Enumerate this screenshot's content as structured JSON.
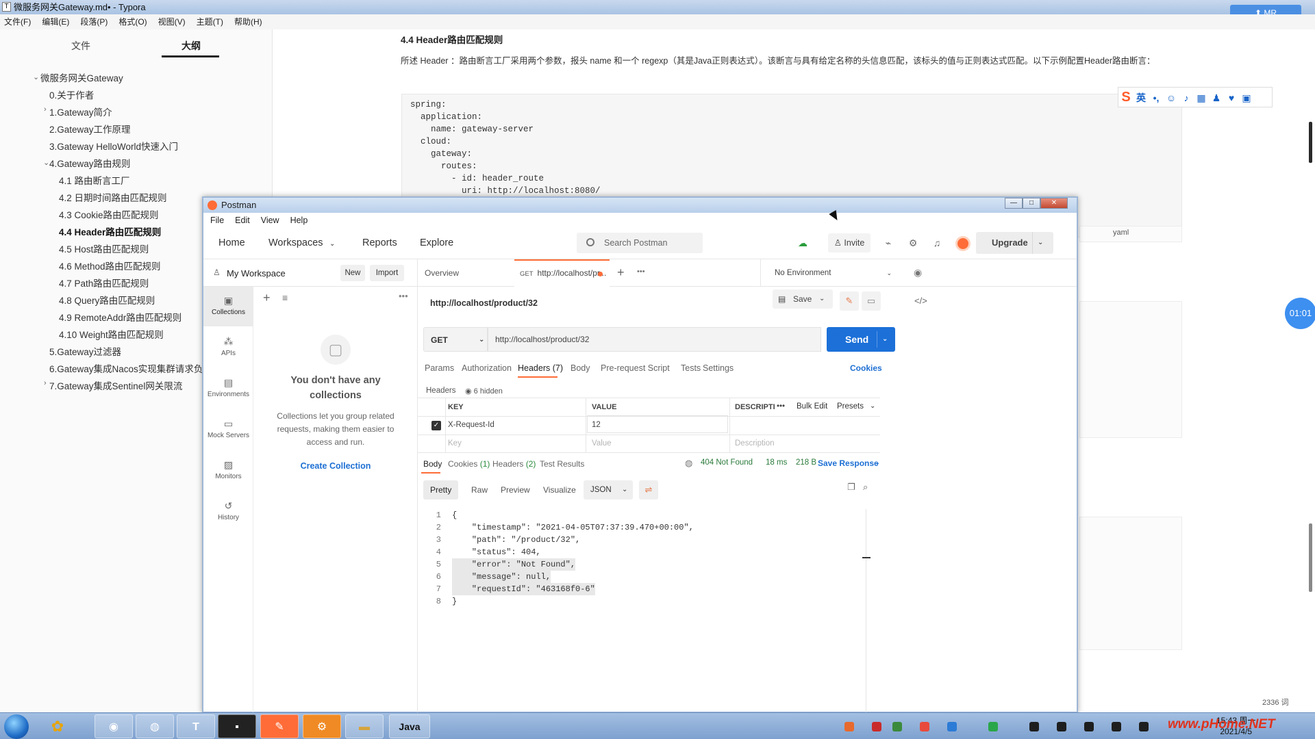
{
  "typora": {
    "window_title": "微服务网关Gateway.md• - Typora",
    "menu": [
      "文件(F)",
      "编辑(E)",
      "段落(P)",
      "格式(O)",
      "视图(V)",
      "主题(T)",
      "帮助(H)"
    ],
    "sidebar_tabs": {
      "files": "文件",
      "outline": "大纲"
    },
    "outline": [
      {
        "label": "微服务网关Gateway",
        "expanded": true
      },
      {
        "label": "0.关于作者"
      },
      {
        "label": "1.Gateway简介",
        "collapsed": true
      },
      {
        "label": "2.Gateway工作原理"
      },
      {
        "label": "3.Gateway HelloWorld快速入门"
      },
      {
        "label": "4.Gateway路由规则",
        "expanded": true
      },
      {
        "label": "4.1 路由断言工厂"
      },
      {
        "label": "4.2 日期时间路由匹配规则"
      },
      {
        "label": "4.3 Cookie路由匹配规则"
      },
      {
        "label": "4.4 Header路由匹配规则",
        "active": true
      },
      {
        "label": "4.5 Host路由匹配规则"
      },
      {
        "label": "4.6 Method路由匹配规则"
      },
      {
        "label": "4.7 Path路由匹配规则"
      },
      {
        "label": "4.8 Query路由匹配规则"
      },
      {
        "label": "4.9 RemoteAddr路由匹配规则"
      },
      {
        "label": "4.10 Weight路由匹配规则"
      },
      {
        "label": "5.Gateway过滤器"
      },
      {
        "label": "6.Gateway集成Nacos实现集群请求负"
      },
      {
        "label": "7.Gateway集成Sentinel网关限流",
        "collapsed": true
      }
    ],
    "doc_heading": "4.4 Header路由匹配规则",
    "doc_paragraph": "所述 Header ：路由断言工厂采用两个参数，报头 name 和一个 regexp（其是Java正则表达式）。该断言与具有给定名称的头信息匹配，该标头的值与正则表达式匹配。以下示例配置Header路由断言：",
    "code_lines": [
      "spring:",
      "  application:",
      "    name: gateway-server",
      "  cloud:",
      "    gateway:",
      "      routes:",
      "        - id: header_route",
      "          uri: http://localhost:8080/"
    ],
    "code_lang_label": "yaml",
    "timer_bubble": "01:01",
    "word_count": "2336 词",
    "ime_labels": {
      "logo": "S",
      "lang": "英"
    }
  },
  "postman": {
    "window_title": "Postman",
    "menu": [
      "File",
      "Edit",
      "View",
      "Help"
    ],
    "nav": [
      "Home",
      "Workspaces",
      "Reports",
      "Explore"
    ],
    "search_placeholder": "Search Postman",
    "invite_label": "Invite",
    "upgrade_label": "Upgrade",
    "workspace_name": "My Workspace",
    "new_label": "New",
    "import_label": "Import",
    "rail": [
      "Collections",
      "APIs",
      "Environments",
      "Mock Servers",
      "Monitors",
      "History"
    ],
    "empty_title": "You don't have any collections",
    "empty_desc": "Collections let you group related requests, making them easier to access and run.",
    "create_collection": "Create Collection",
    "tab_overview": "Overview",
    "tab_method": "GET",
    "tab_url": "http://localhost/pr...",
    "environment": "No Environment",
    "request_title": "http://localhost/product/32",
    "save_label": "Save",
    "method": "GET",
    "url": "http://localhost/product/32",
    "send_label": "Send",
    "request_tabs": [
      "Params",
      "Authorization",
      "Headers (7)",
      "Body",
      "Pre-request Script",
      "Tests",
      "Settings"
    ],
    "cookies_link": "Cookies",
    "headers_sub": "Headers",
    "hidden_label": "6 hidden",
    "table_headers": {
      "key": "KEY",
      "value": "VALUE",
      "description": "DESCRIPTI"
    },
    "bulk_edit": "Bulk Edit",
    "presets": "Presets",
    "header_row": {
      "key": "X-Request-Id",
      "value": "12"
    },
    "placeholder_row": {
      "key": "Key",
      "value": "Value",
      "description": "Description"
    },
    "response_tabs": {
      "body": "Body",
      "cookies": "Cookies",
      "cookies_count": "(1)",
      "headers": "Headers",
      "headers_count": "(2)",
      "tests": "Test Results"
    },
    "status": "404 Not Found",
    "time": "18 ms",
    "size": "218 B",
    "save_response": "Save Response",
    "format_tabs": [
      "Pretty",
      "Raw",
      "Preview",
      "Visualize"
    ],
    "format_select": "JSON",
    "response_lines": [
      "{",
      "    \"timestamp\": \"2021-04-05T07:37:39.470+00:00\",",
      "    \"path\": \"/product/32\",",
      "    \"status\": 404,",
      "    \"error\": \"Not Found\",",
      "    \"message\": null,",
      "    \"requestId\": \"463168f0-6\"",
      "}"
    ]
  },
  "taskbar": {
    "time": "15:43 周一",
    "date": "2021/4/5",
    "java_label": "Java",
    "typora_label": "T",
    "watermark": "www.pHome.NET"
  },
  "colors": {
    "postman_orange": "#ff6c37",
    "send_blue": "#1c70d8",
    "status_green": "#2a7a3a"
  }
}
